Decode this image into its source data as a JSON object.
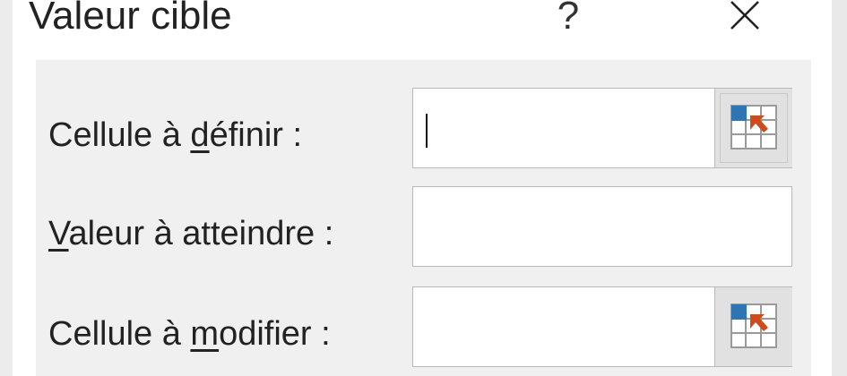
{
  "dialog": {
    "title": "Valeur cible",
    "help_glyph": "?",
    "close_icon": "close-icon"
  },
  "fields": [
    {
      "label_before": "Cellule à ",
      "label_mnemonic": "d",
      "label_after": "éfinir :",
      "value": "",
      "has_ref_button": true,
      "focused": true
    },
    {
      "label_before": "",
      "label_mnemonic": "V",
      "label_after": "aleur à atteindre :",
      "value": "",
      "has_ref_button": false,
      "focused": false
    },
    {
      "label_before": "Cellule à ",
      "label_mnemonic": "m",
      "label_after": "odifier :",
      "value": "",
      "has_ref_button": true,
      "focused": false
    }
  ],
  "icons": {
    "ref_button_icon": "collapse-dialog-range-icon"
  },
  "colors": {
    "panel_bg": "#f0f0f0",
    "ref_icon_blue": "#2e75b6",
    "ref_icon_arrow": "#d04a1a"
  }
}
